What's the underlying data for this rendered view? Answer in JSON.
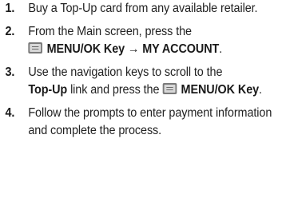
{
  "steps": [
    {
      "num": "1.",
      "text": "Buy a Top-Up card from any available retailer."
    },
    {
      "num": "2.",
      "prefix": "From the Main screen, press the",
      "key_icon": "menu-ok-key-icon",
      "key_label": "MENU/OK Key",
      "arrow": "→",
      "target": "MY ACCOUNT",
      "suffix": "."
    },
    {
      "num": "3.",
      "prefix": "Use the navigation keys to scroll to the",
      "link": "Top-Up",
      "middle": "link and press the",
      "key_icon": "menu-ok-key-icon",
      "key_label": "MENU/OK Key",
      "suffix": "."
    },
    {
      "num": "4.",
      "text": "Follow the prompts to enter payment information and complete the process."
    }
  ]
}
